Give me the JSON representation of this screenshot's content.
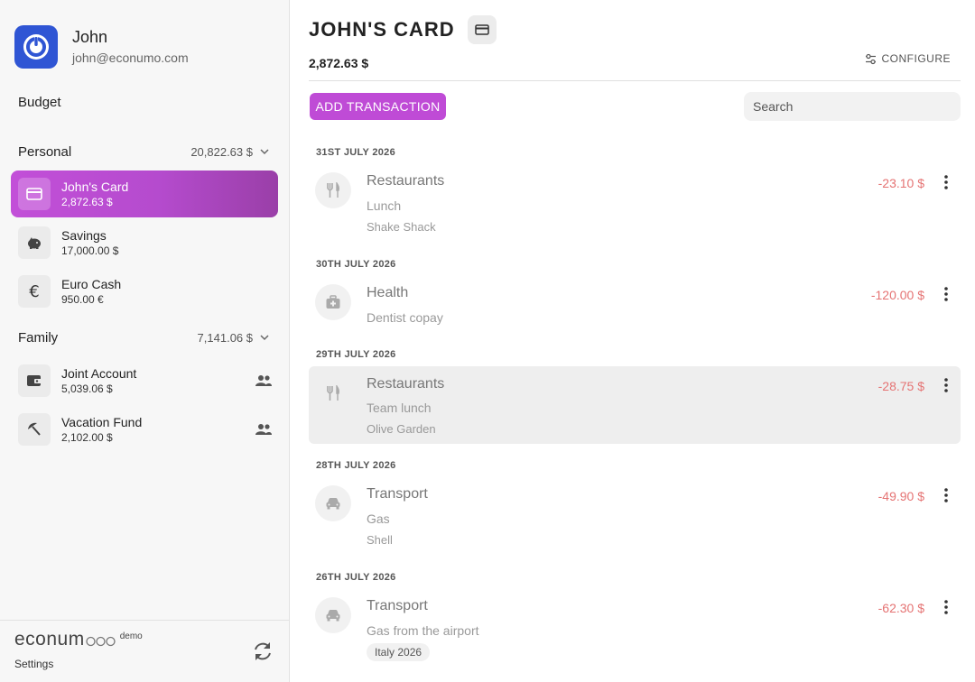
{
  "user": {
    "name": "John",
    "email": "john@econumo.com"
  },
  "nav": {
    "budget_label": "Budget"
  },
  "folders": [
    {
      "name": "Personal",
      "balance": "20,822.63 $",
      "accounts": [
        {
          "name": "John's Card",
          "balance": "2,872.63 $",
          "icon": "credit-card-icon",
          "active": true
        },
        {
          "name": "Savings",
          "balance": "17,000.00 $",
          "icon": "piggy-bank-icon"
        },
        {
          "name": "Euro Cash",
          "balance": "950.00 €",
          "icon": "euro-icon"
        }
      ]
    },
    {
      "name": "Family",
      "balance": "7,141.06 $",
      "accounts": [
        {
          "name": "Joint Account",
          "balance": "5,039.06 $",
          "icon": "wallet-icon",
          "shared": true
        },
        {
          "name": "Vacation Fund",
          "balance": "2,102.00 $",
          "icon": "beach-umbrella-icon",
          "shared": true
        }
      ]
    }
  ],
  "footer": {
    "brand": "econum",
    "brand_demo": "demo",
    "settings_label": "Settings"
  },
  "account_view": {
    "title": "JOHN'S CARD",
    "balance": "2,872.63 $",
    "configure_label": "CONFIGURE",
    "add_transaction_label": "ADD TRANSACTION",
    "search_placeholder": "Search"
  },
  "transactions": [
    {
      "date": "31ST JULY 2026",
      "category": "Restaurants",
      "description": "Lunch",
      "payee": "Shake Shack",
      "amount": "-23.10 $",
      "icon": "fork-knife-icon"
    },
    {
      "date": "30TH JULY 2026",
      "category": "Health",
      "description": "Dentist copay",
      "amount": "-120.00 $",
      "icon": "medical-bag-icon"
    },
    {
      "date": "29TH JULY 2026",
      "category": "Restaurants",
      "description": "Team lunch",
      "payee": "Olive Garden",
      "amount": "-28.75 $",
      "icon": "fork-knife-icon",
      "highlighted": true
    },
    {
      "date": "28TH JULY 2026",
      "category": "Transport",
      "description": "Gas",
      "payee": "Shell",
      "amount": "-49.90 $",
      "icon": "car-icon"
    },
    {
      "date": "26TH JULY 2026",
      "category": "Transport",
      "description": "Gas from the airport",
      "tag": "Italy 2026",
      "amount": "-62.30 $",
      "icon": "car-icon"
    }
  ],
  "colors": {
    "accent": "#bf4bd6",
    "negative_amount": "#e57373",
    "logo_blue": "#2f55d4"
  }
}
